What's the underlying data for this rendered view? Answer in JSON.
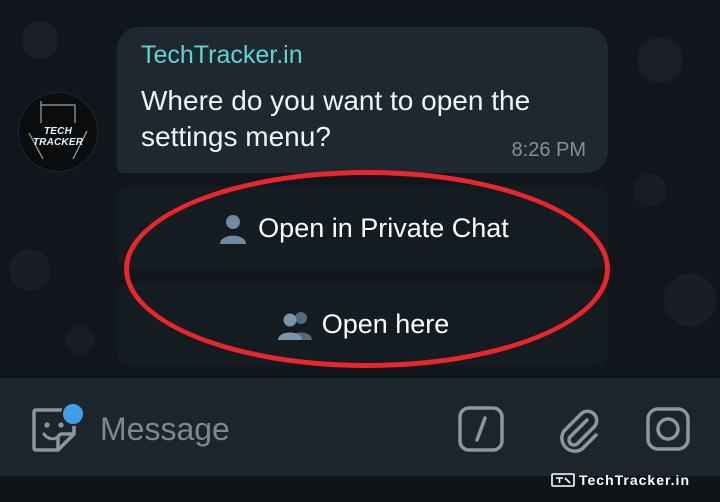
{
  "message": {
    "sender": "TechTracker.in",
    "text": "Where do you want to open the settings menu?",
    "time": "8:26 PM",
    "avatar_text": "TECH TRACKER"
  },
  "keyboard": {
    "buttons": [
      {
        "emoji": "👤",
        "label": "Open in Private Chat"
      },
      {
        "emoji": "👥",
        "label": "Open here"
      }
    ]
  },
  "composer": {
    "placeholder": "Message"
  },
  "watermark": {
    "text": "TechTracker.in"
  },
  "colors": {
    "sender": "#5fd3cf",
    "highlight": "#e8262b",
    "notification_dot": "#3fa0e8",
    "bubble": "#1f2830",
    "composer": "#1d252c"
  }
}
